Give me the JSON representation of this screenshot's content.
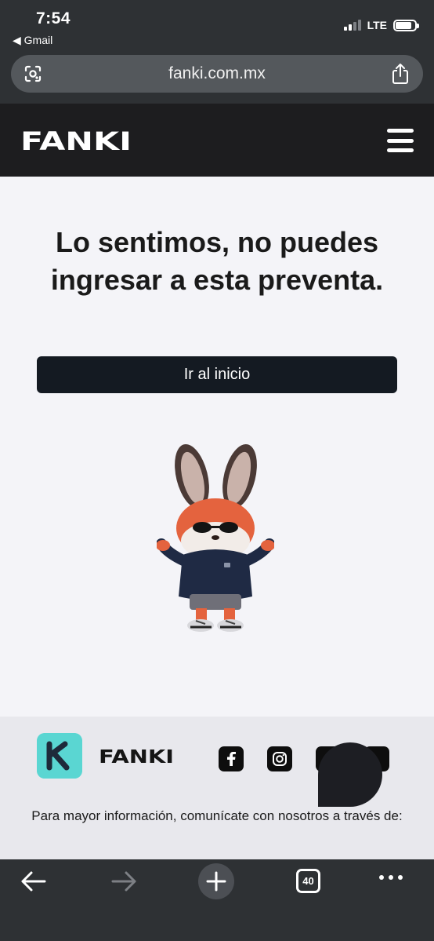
{
  "status_bar": {
    "time": "7:54",
    "back_app": "◀ Gmail",
    "network": "LTE",
    "signal_bars_active": 2,
    "signal_bars_total": 4
  },
  "browser": {
    "url": "fanki.com.mx",
    "open_tabs": "40"
  },
  "site": {
    "logo_text": "FANKI",
    "headline_line1": "Lo sentimos, no puedes",
    "headline_line2": "ingresar a esta preventa.",
    "home_button": "Ir al inicio"
  },
  "footer": {
    "logo_text": "FANKI",
    "contact_text": "Para mayor información, comunícate con nosotros a través de:",
    "social_icons": [
      "facebook-icon",
      "instagram-icon",
      "youtube-icon",
      "tiktok-icon"
    ]
  },
  "colors": {
    "header_bg": "#1d1d1f",
    "button_bg": "#141a22",
    "app_icon": "#5ad6d2",
    "page_bg": "#f4f4f8"
  }
}
